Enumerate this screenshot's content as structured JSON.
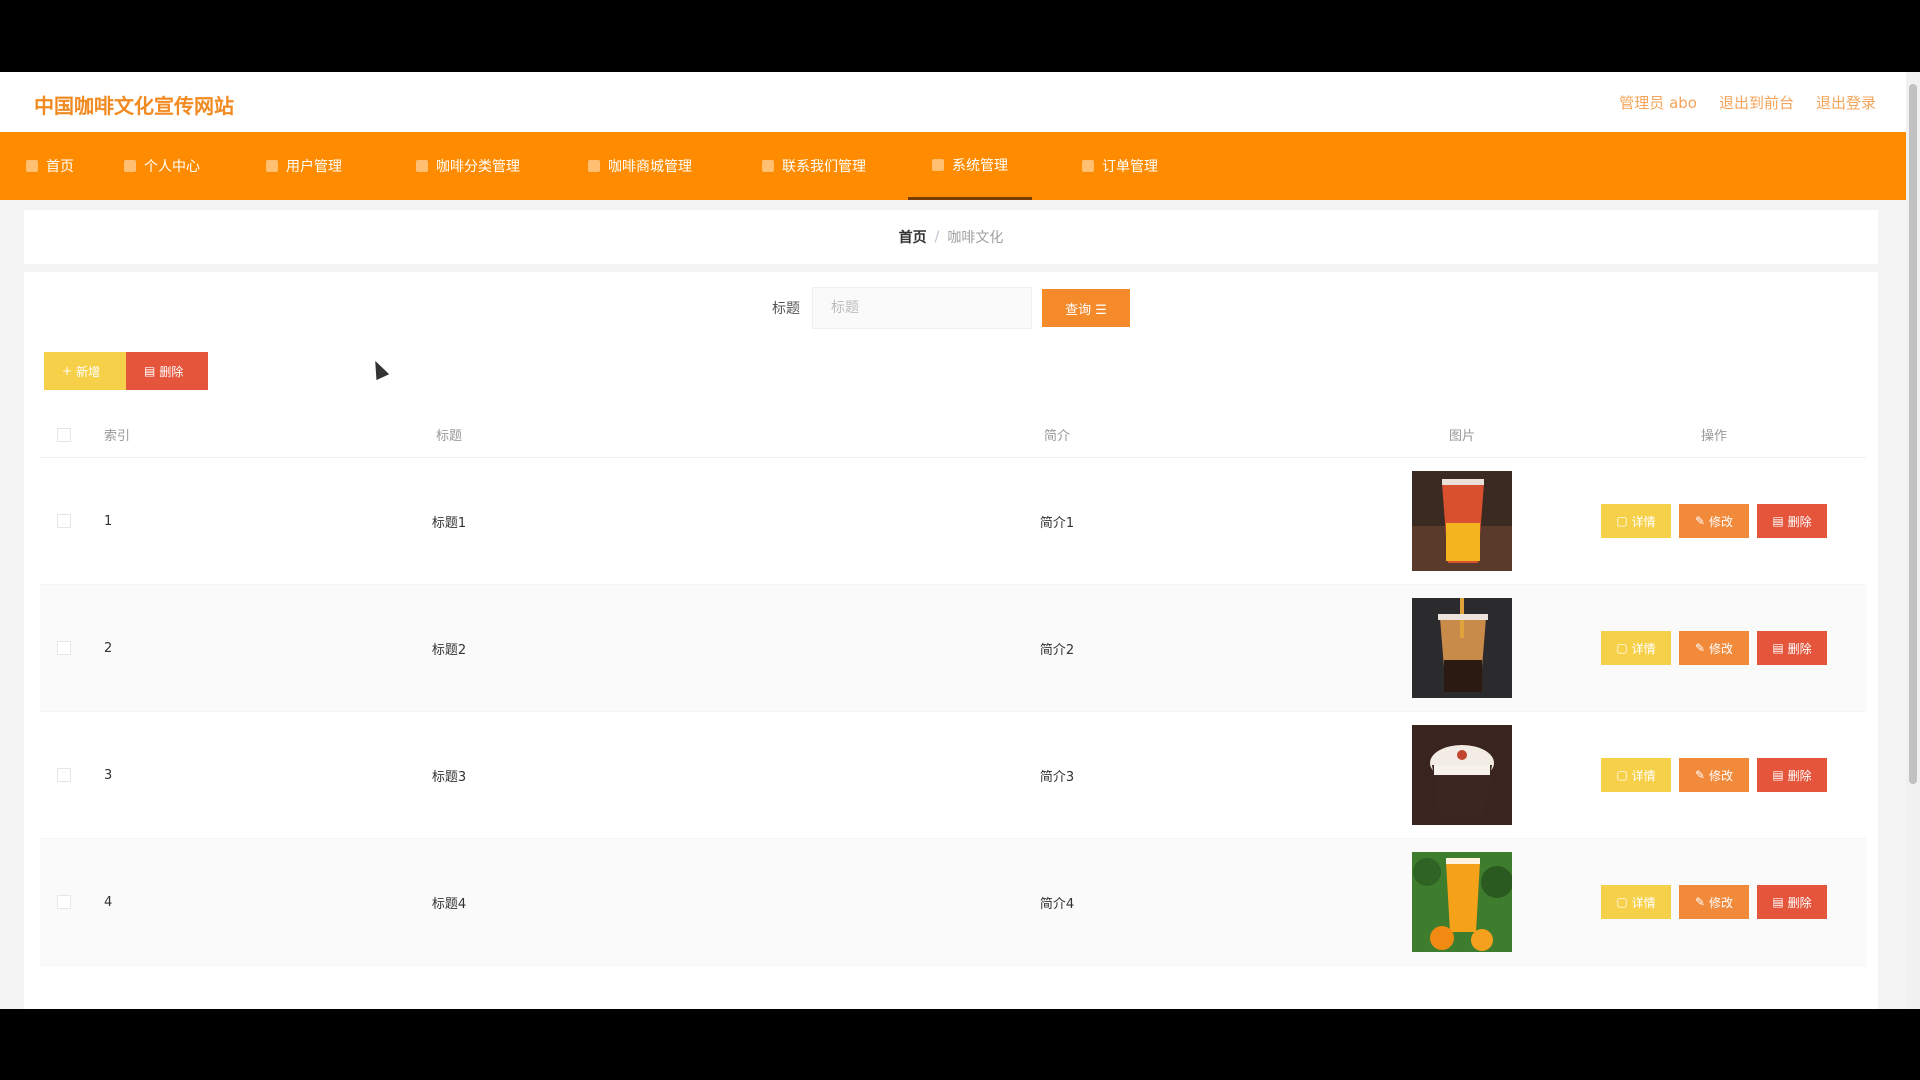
{
  "header": {
    "site_title": "中国咖啡文化宣传网站",
    "links": [
      "管理员 abo",
      "退出到前台",
      "退出登录"
    ]
  },
  "nav": {
    "items": [
      {
        "label": "首页",
        "icon": "home-icon"
      },
      {
        "label": "个人中心",
        "icon": "user-icon"
      },
      {
        "label": "用户管理",
        "icon": "users-icon"
      },
      {
        "label": "咖啡分类管理",
        "icon": "category-icon"
      },
      {
        "label": "咖啡商城管理",
        "icon": "shop-icon"
      },
      {
        "label": "联系我们管理",
        "icon": "contact-icon"
      },
      {
        "label": "系统管理",
        "icon": "settings-icon"
      },
      {
        "label": "订单管理",
        "icon": "order-icon"
      }
    ],
    "active_index": 6
  },
  "breadcrumb": {
    "home": "首页",
    "separator": "/",
    "current": "咖啡文化"
  },
  "search": {
    "label": "标题",
    "placeholder": "标题",
    "button": "查询"
  },
  "actions": {
    "add": "新增",
    "delete": "删除"
  },
  "table": {
    "headers": [
      "索引",
      "标题",
      "简介",
      "图片",
      "操作"
    ],
    "rows": [
      {
        "index": "1",
        "title": "标题1",
        "intro": "简介1",
        "image": "red-orange-drink"
      },
      {
        "index": "2",
        "title": "标题2",
        "intro": "简介2",
        "image": "boba-milk-tea"
      },
      {
        "index": "3",
        "title": "标题3",
        "intro": "简介3",
        "image": "cream-coffee"
      },
      {
        "index": "4",
        "title": "标题4",
        "intro": "简介4",
        "image": "orange-juice"
      }
    ],
    "ops": {
      "detail": "详情",
      "edit": "修改",
      "remove": "删除"
    }
  },
  "colors": {
    "accent": "#ff8c00",
    "yellow": "#f7d04a",
    "red": "#e4553c"
  }
}
